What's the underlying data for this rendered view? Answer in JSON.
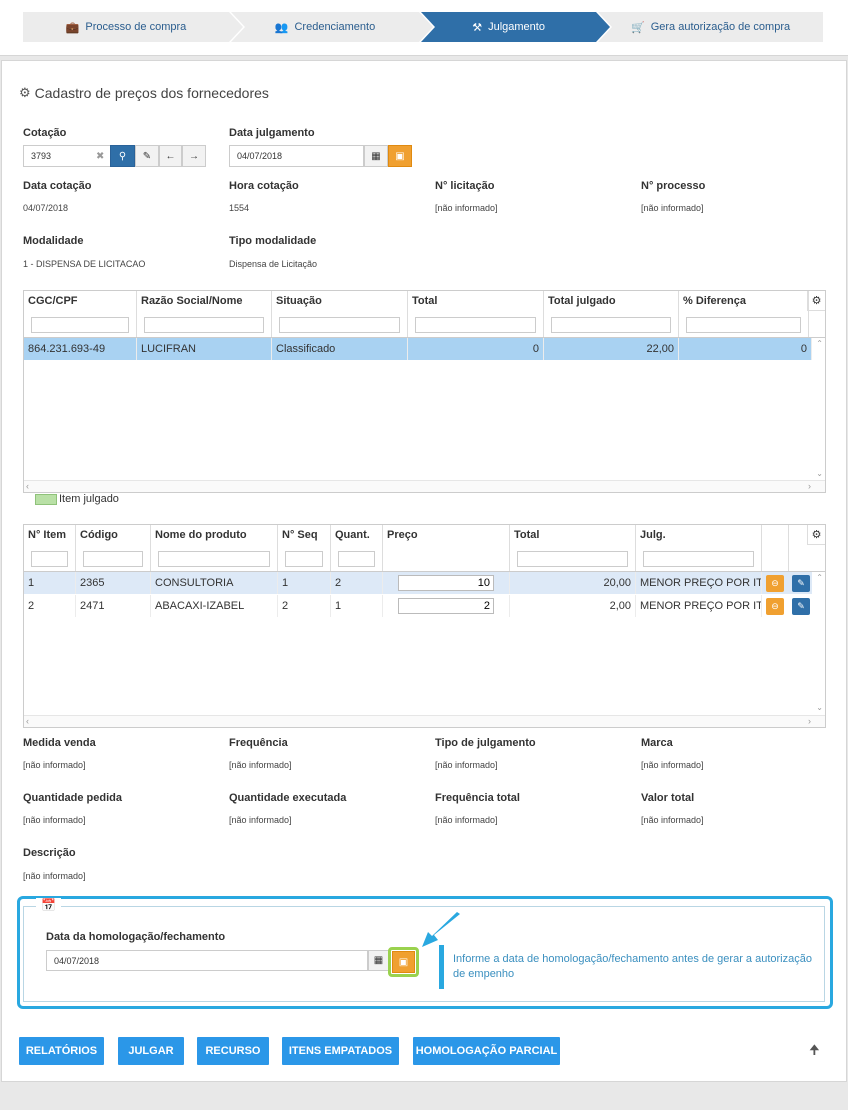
{
  "wizard": {
    "steps": [
      {
        "label": "Processo de compra",
        "icon": "briefcase-icon"
      },
      {
        "label": "Credenciamento",
        "icon": "users-icon"
      },
      {
        "label": "Julgamento",
        "icon": "gavel-icon"
      },
      {
        "label": "Gera autorização de compra",
        "icon": "cart-icon"
      }
    ],
    "active_index": 2
  },
  "page": {
    "title": "Cadastro de preços dos fornecedores"
  },
  "cotacao": {
    "label": "Cotação",
    "value": "3793"
  },
  "data_julgamento": {
    "label": "Data julgamento",
    "value": "04/07/2018"
  },
  "info": {
    "data_cotacao": {
      "label": "Data cotação",
      "value": "04/07/2018"
    },
    "hora_cotacao": {
      "label": "Hora cotação",
      "value": "1554"
    },
    "n_licitacao": {
      "label": "N° licitação",
      "value": "[não informado]"
    },
    "n_processo": {
      "label": "N° processo",
      "value": "[não informado]"
    },
    "modalidade": {
      "label": "Modalidade",
      "value": "1 - DISPENSA DE LICITACAO"
    },
    "tipo_modalidade": {
      "label": "Tipo modalidade",
      "value": "Dispensa de Licitação"
    }
  },
  "suppliers_grid": {
    "columns": [
      "CGC/CPF",
      "Razão Social/Nome",
      "Situação",
      "Total",
      "Total julgado",
      "% Diferença"
    ],
    "rows": [
      [
        "864.231.693-49",
        "LUCIFRAN",
        "Classificado",
        "0",
        "22,00",
        "0"
      ]
    ]
  },
  "legend": {
    "label": "Item julgado",
    "color": "#b9e0a6"
  },
  "items_grid": {
    "columns": [
      "N° Item",
      "Código",
      "Nome do produto",
      "N° Seq",
      "Quant.",
      "Preço",
      "Total",
      "Julg."
    ],
    "rows": [
      {
        "item": "1",
        "codigo": "2365",
        "nome": "CONSULTORIA",
        "seq": "1",
        "quant": "2",
        "preco": "10",
        "total": "20,00",
        "julg": "MENOR PREÇO POR IT..."
      },
      {
        "item": "2",
        "codigo": "2471",
        "nome": "ABACAXI-IZABEL",
        "seq": "2",
        "quant": "1",
        "preco": "2",
        "total": "2,00",
        "julg": "MENOR PREÇO POR IT..."
      }
    ]
  },
  "details": {
    "medida_venda": {
      "label": "Medida venda",
      "value": "[não informado]"
    },
    "frequencia": {
      "label": "Frequência",
      "value": "[não informado]"
    },
    "tipo_julgamento": {
      "label": "Tipo de julgamento",
      "value": "[não informado]"
    },
    "marca": {
      "label": "Marca",
      "value": "[não informado]"
    },
    "quantidade_pedida": {
      "label": "Quantidade pedida",
      "value": "[não informado]"
    },
    "quantidade_executada": {
      "label": "Quantidade executada",
      "value": "[não informado]"
    },
    "frequencia_total": {
      "label": "Frequência total",
      "value": "[não informado]"
    },
    "valor_total": {
      "label": "Valor total",
      "value": "[não informado]"
    },
    "descricao": {
      "label": "Descrição",
      "value": "[não informado]"
    }
  },
  "homologacao": {
    "label": "Data da homologação/fechamento",
    "value": "04/07/2018",
    "hint": "Informe a data de homologação/fechamento antes de gerar a autorização de empenho"
  },
  "actions": [
    "RELATÓRIOS",
    "JULGAR",
    "RECURSO",
    "ITENS EMPATADOS",
    "HOMOLOGAÇÃO PARCIAL"
  ],
  "colors": {
    "primary": "#2f6fa8",
    "orange": "#f0a030",
    "action": "#2b97e8",
    "highlight": "#29a8e0",
    "selected_row": "#a9d2f2"
  }
}
